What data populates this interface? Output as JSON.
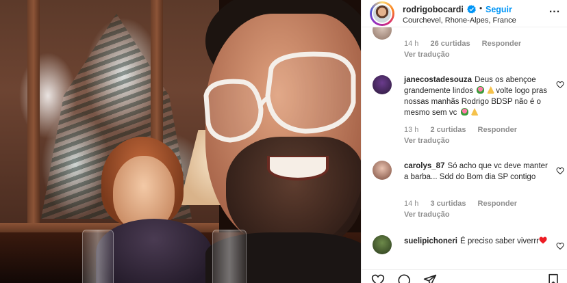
{
  "header": {
    "username": "rodrigobocardi",
    "separator": "•",
    "follow_label": "Seguir",
    "location": "Courchevel, Rhone-Alpes, France",
    "more_label": "..."
  },
  "comments": [
    {
      "username": "",
      "text": "",
      "time": "14 h",
      "likes": "26 curtidas",
      "reply": "Responder",
      "translate": "Ver tradução"
    },
    {
      "username": "janecostadesouza",
      "text_1": "Deus os abençoe grandemente lindos",
      "text_2": "volte logo pras nossas manhãs Rodrigo BDSP não é o mesmo sem vc",
      "time": "13 h",
      "likes": "2 curtidas",
      "reply": "Responder",
      "translate": "Ver tradução"
    },
    {
      "username": "carolys_87",
      "text": "Só acho que vc deve manter a barba... Sdd do Bom dia SP contigo",
      "time": "14 h",
      "likes": "3 curtidas",
      "reply": "Responder",
      "translate": "Ver tradução"
    },
    {
      "username": "suelipichoneri",
      "text": "É preciso saber viverrr"
    }
  ],
  "icons": {
    "verified": "verified-badge-icon",
    "like": "heart-icon",
    "comment": "comment-icon",
    "share": "paper-plane-icon",
    "save": "bookmark-icon"
  },
  "colors": {
    "link_blue": "#0095f6",
    "text": "#262626",
    "muted": "#8e8e8e",
    "heart_red": "#ed4956"
  }
}
